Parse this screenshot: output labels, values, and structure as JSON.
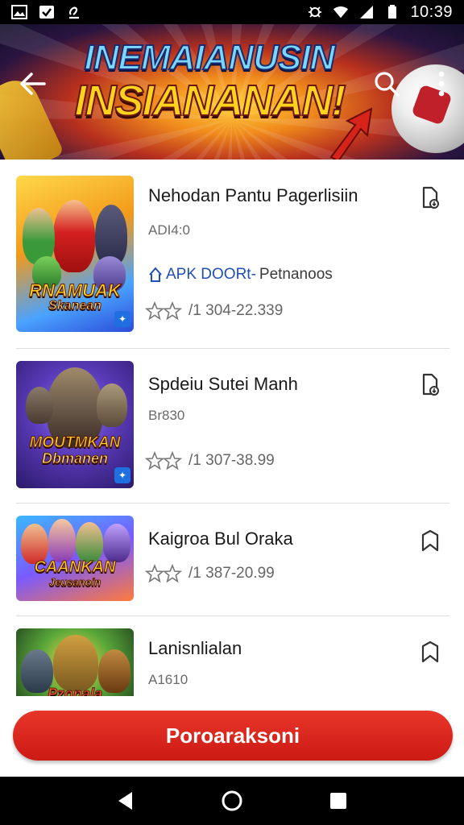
{
  "status_bar": {
    "time": "10:39",
    "left_icons": [
      "image-icon",
      "check-box-icon",
      "clip-icon"
    ],
    "right_icons": [
      "bug-icon",
      "wifi-icon",
      "signal-icon",
      "battery-icon"
    ]
  },
  "header": {
    "banner_title_line1": "INEMAIANUSIN",
    "banner_title_line2": "INSIANANAN!",
    "back_icon": "arrow-left-icon",
    "search_icon": "search-icon",
    "more_icon": "more-vertical-icon"
  },
  "items": [
    {
      "title": "Nehodan Pantu Pagerlisiin",
      "subtitle": "ADI4:0",
      "link_apk": "APK DOORt-",
      "link_rest": "Petnanoos",
      "rating_text": "/1 304-22.339",
      "art_line1": "RNAMUAK",
      "art_line2": "Skanean",
      "action_icon": "download-icon"
    },
    {
      "title": "Spdeiu Sutei Manh",
      "subtitle": "Br830",
      "rating_text": "/1 307-38.99",
      "art_line1": "MOUTMKAN",
      "art_line2": "Dbmanen",
      "action_icon": "download-icon"
    },
    {
      "title": "Kaigroa Bul Oraka",
      "rating_text": "/1 387-20.99",
      "art_line1": "CAANKAN",
      "art_line2": "Jeusanoin",
      "action_icon": "bookmark-icon"
    },
    {
      "title": "Lanisnlialan",
      "subtitle": "A1610",
      "art_line1": "Pzonala",
      "action_icon": "bookmark-icon"
    }
  ],
  "cta": {
    "label": "Poroaraksoni"
  },
  "nav": {
    "icons": [
      "back-triangle-icon",
      "home-circle-icon",
      "recents-square-icon"
    ]
  },
  "colors": {
    "accent": "#d8231b",
    "link": "#1f4fb8"
  }
}
